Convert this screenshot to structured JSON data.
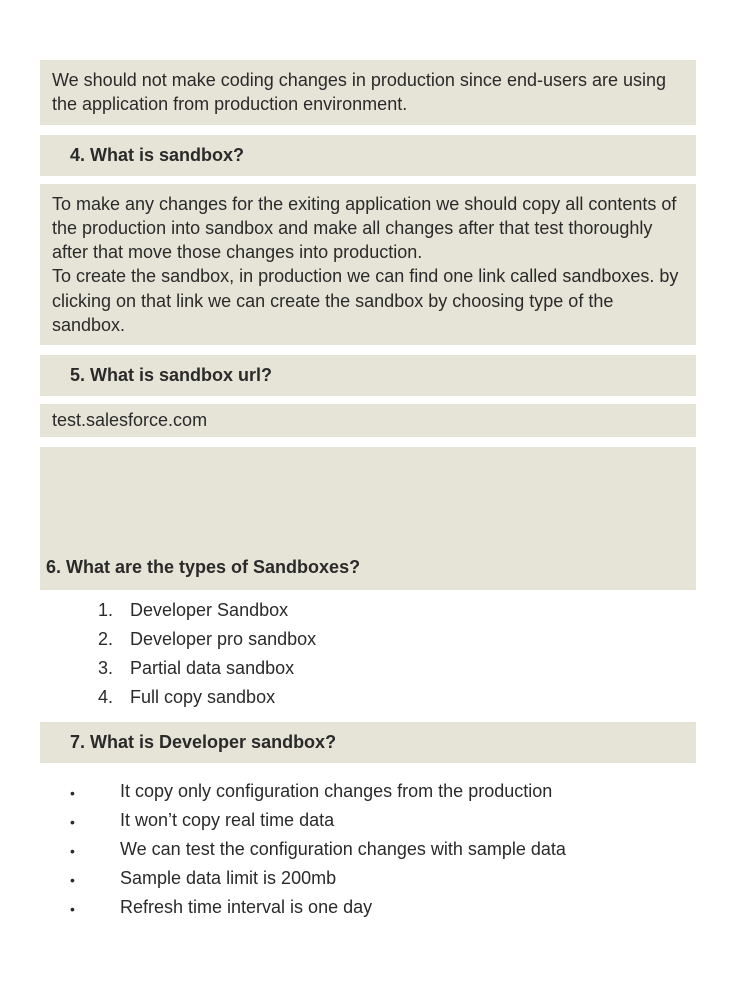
{
  "intro_para": "We should not make coding changes in production since end-users are using the application from production environment.",
  "q4": {
    "heading": "4. What is sandbox?",
    "answer": "To make any changes for the exiting application we should copy all contents of the production into sandbox and make all changes after that test thoroughly after that move those changes into production.\nTo create the sandbox, in production we can find one link called sandboxes. by clicking on that link we can create the sandbox by choosing type of the sandbox."
  },
  "q5": {
    "heading": "5. What is sandbox url?",
    "answer": "test.salesforce.com"
  },
  "q6": {
    "heading": "6. What are the types of Sandboxes?",
    "items": [
      "Developer Sandbox",
      "Developer pro sandbox",
      "Partial data sandbox",
      "Full copy sandbox"
    ]
  },
  "q7": {
    "heading": "7. What is Developer sandbox?",
    "items": [
      "It copy only configuration changes from the production",
      "It won’t copy real time data",
      "We can test the configuration changes with sample data",
      "Sample data limit is 200mb",
      "Refresh time interval is one day"
    ]
  }
}
